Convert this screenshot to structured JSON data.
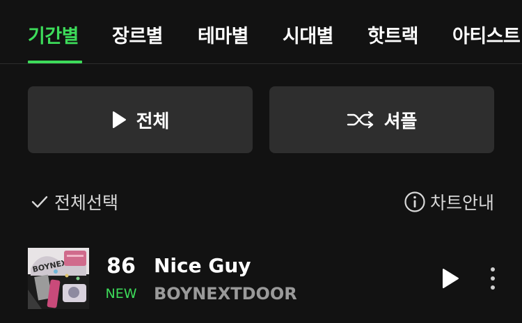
{
  "tabs": [
    {
      "label": "기간별",
      "active": true
    },
    {
      "label": "장르별",
      "active": false
    },
    {
      "label": "테마별",
      "active": false
    },
    {
      "label": "시대별",
      "active": false
    },
    {
      "label": "핫트랙",
      "active": false
    },
    {
      "label": "아티스트",
      "active": false
    }
  ],
  "actions": {
    "play_all_label": "전체",
    "shuffle_label": "셔플"
  },
  "list_controls": {
    "select_all_label": "전체선택",
    "chart_info_label": "차트안내"
  },
  "songs": [
    {
      "rank": "86",
      "rank_change": "NEW",
      "title": "Nice Guy",
      "artist": "BOYNEXTDOOR"
    }
  ],
  "colors": {
    "accent": "#3ddc5a",
    "background": "#121212",
    "button_bg": "#2e2e2e"
  }
}
